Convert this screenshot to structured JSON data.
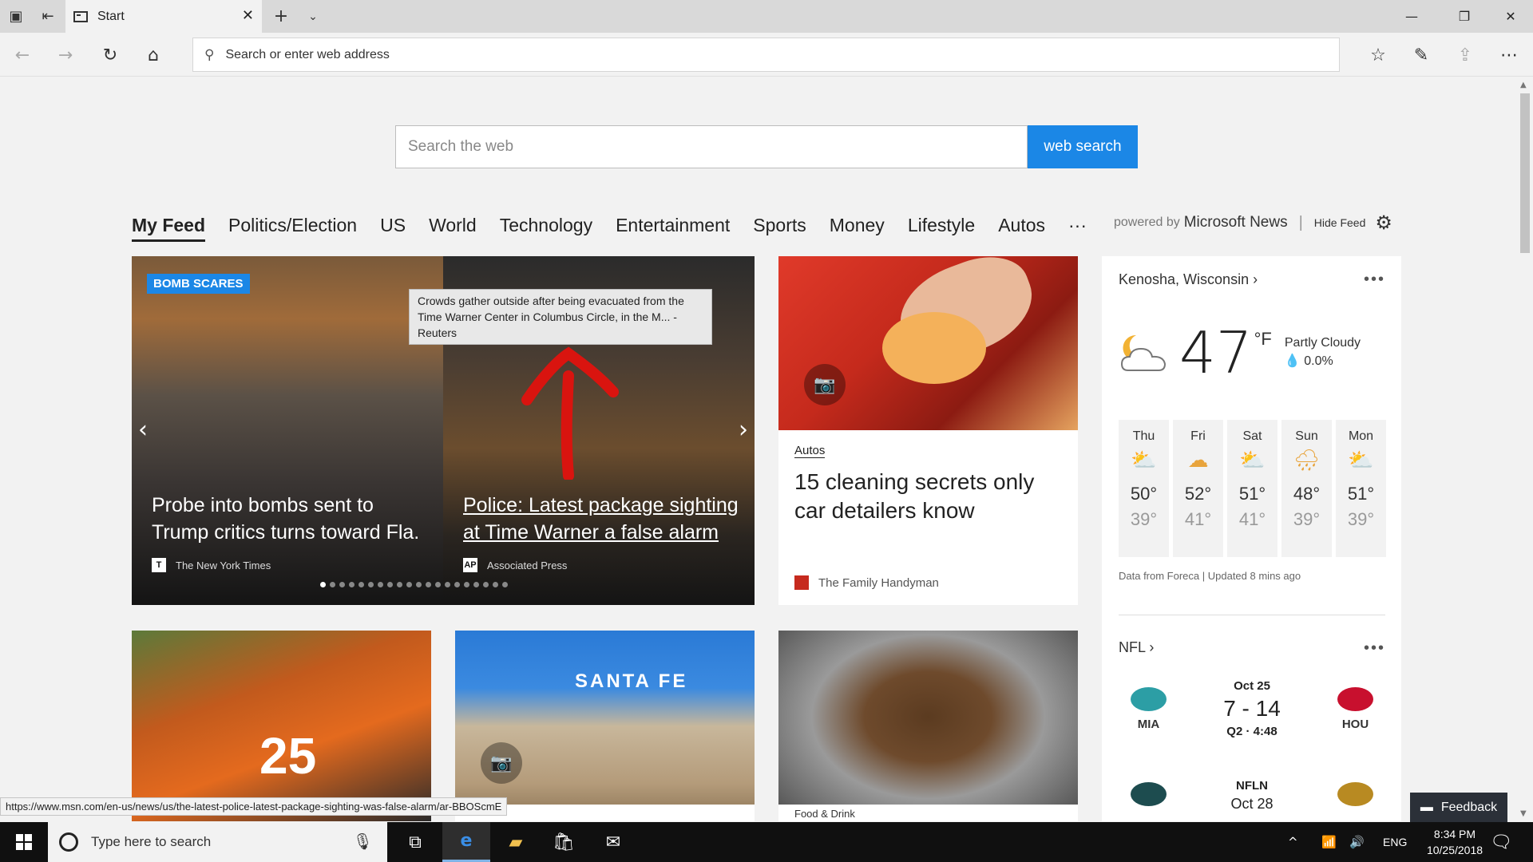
{
  "browser": {
    "tab_title": "Start",
    "address_placeholder": "Search or enter web address"
  },
  "search": {
    "placeholder": "Search the web",
    "button_label": "web search"
  },
  "feed_nav": {
    "items": [
      "My Feed",
      "Politics/Election",
      "US",
      "World",
      "Technology",
      "Entertainment",
      "Sports",
      "Money",
      "Lifestyle",
      "Autos",
      "···"
    ],
    "powered_by_prefix": "powered by",
    "powered_by_name": "Microsoft News",
    "hide_feed": "Hide Feed"
  },
  "hero": {
    "badge": "BOMB SCARES",
    "tooltip": "Crowds gather outside after being evacuated from the Time Warner Center in Columbus Circle, in the M... - Reuters",
    "left_headline": "Probe into bombs sent to Trump critics turns toward Fla.",
    "left_source": "The New York Times",
    "left_source_logo": "T",
    "right_headline": "Police: Latest package sighting at Time Warner a false alarm",
    "right_source": "Associated Press",
    "right_source_logo": "AP",
    "dots_count": 20,
    "active_dot": 0
  },
  "card_autos": {
    "category": "Autos",
    "title": "15 cleaning secrets only car detailers know",
    "source": "The Family Handyman"
  },
  "row2": {
    "jersey_number": "25",
    "sign_text": "SANTA FE",
    "partial_caption": "Food & Drink"
  },
  "weather": {
    "location": "Kenosha, Wisconsin",
    "temp": "47",
    "unit": "°F",
    "condition": "Partly Cloudy",
    "precip": "0.0%",
    "forecast": [
      {
        "day": "Thu",
        "hi": "50°",
        "lo": "39°"
      },
      {
        "day": "Fri",
        "hi": "52°",
        "lo": "41°"
      },
      {
        "day": "Sat",
        "hi": "51°",
        "lo": "41°"
      },
      {
        "day": "Sun",
        "hi": "48°",
        "lo": "39°"
      },
      {
        "day": "Mon",
        "hi": "51°",
        "lo": "39°"
      }
    ],
    "credit": "Data from Foreca | Updated 8 mins ago"
  },
  "nfl": {
    "title": "NFL",
    "game1": {
      "away": "MIA",
      "home": "HOU",
      "date": "Oct 25",
      "score": "7 - 14",
      "status": "Q2 · 4:48"
    },
    "game2": {
      "network": "NFLN",
      "date": "Oct 28"
    }
  },
  "feedback_label": "Feedback",
  "status_url": "https://www.msn.com/en-us/news/us/the-latest-police-latest-package-sighting-was-false-alarm/ar-BBOScmE",
  "taskbar": {
    "search_placeholder": "Type here to search",
    "language": "ENG",
    "time": "8:34 PM",
    "date": "10/25/2018"
  },
  "colors": {
    "accent": "#1b87e6",
    "taskbar": "#101010"
  }
}
